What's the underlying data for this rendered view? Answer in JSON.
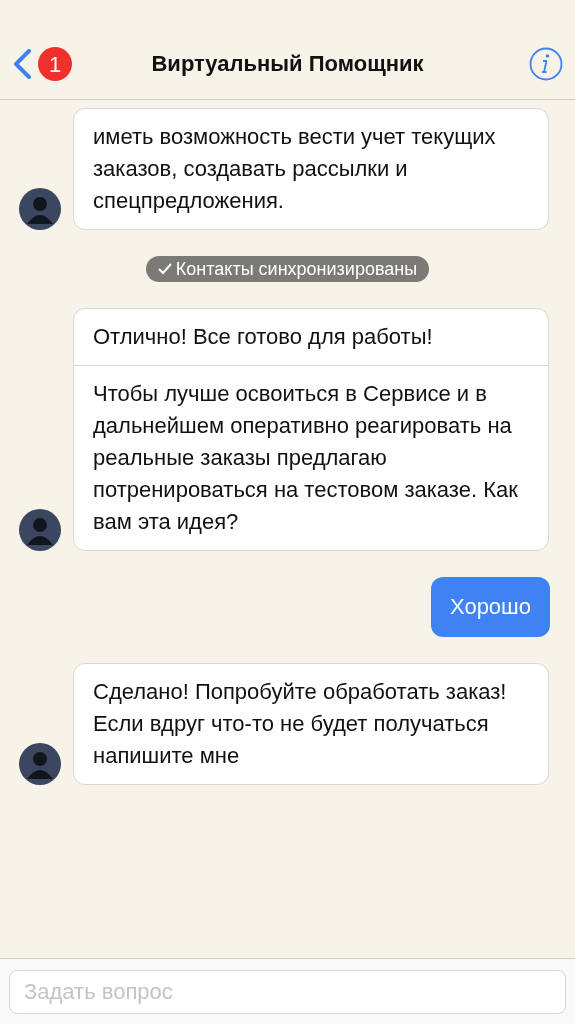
{
  "header": {
    "back_badge": "1",
    "title": "Виртуальный Помощник"
  },
  "messages": [
    {
      "kind": "bot",
      "sections": [
        "иметь возможность вести учет текущих заказов, создавать рассылки и спецпредложения."
      ]
    },
    {
      "kind": "notice",
      "text": "Контакты синхронизированы"
    },
    {
      "kind": "bot",
      "sections": [
        "Отлично! Все готово для работы!",
        "Чтобы лучше освоиться в Сервисе и в дальнейшем оперативно реагировать на реальные заказы предлагаю потренироваться на тестовом заказе. Как вам эта идея?"
      ]
    },
    {
      "kind": "user",
      "text": "Хорошо"
    },
    {
      "kind": "bot",
      "sections": [
        "Сделано! Попробуйте обработать заказ! Если вдруг что-то не будет получаться напишите мне"
      ]
    }
  ],
  "input": {
    "placeholder": "Задать вопрос"
  }
}
